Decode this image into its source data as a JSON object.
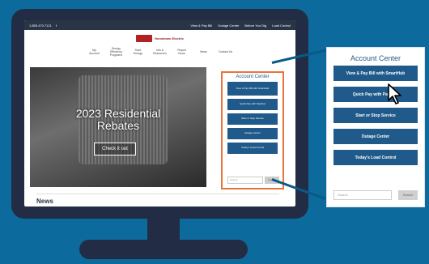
{
  "site": {
    "phone": "1.855.470.7121",
    "social_icon": "facebook-icon",
    "top_links": [
      "View & Pay Bill",
      "Outage Center",
      "Before You Dig",
      "Load Control"
    ],
    "logo_text": "Hometown Electric",
    "nav_items": [
      "My Account",
      "Energy Efficiency Programs",
      "Save Energy",
      "Info & Resources",
      "Report Issue",
      "News",
      "Contact Us"
    ]
  },
  "hero": {
    "title_line1": "2023 Residential",
    "title_line2": "Rebates",
    "cta_label": "Check it out"
  },
  "news": {
    "heading": "News"
  },
  "account_center": {
    "title": "Account Center",
    "buttons": [
      "View & Pay Bill with SmartHub",
      "Quick Pay with PayNow",
      "Start or Stop Service",
      "Outage Center",
      "Today's Load Control"
    ],
    "search_placeholder": "Search",
    "search_button": "Search"
  },
  "colors": {
    "background": "#0c6a9c",
    "monitor": "#222c44",
    "accent_blue": "#1f5a8a",
    "highlight_orange": "#e8743b"
  }
}
